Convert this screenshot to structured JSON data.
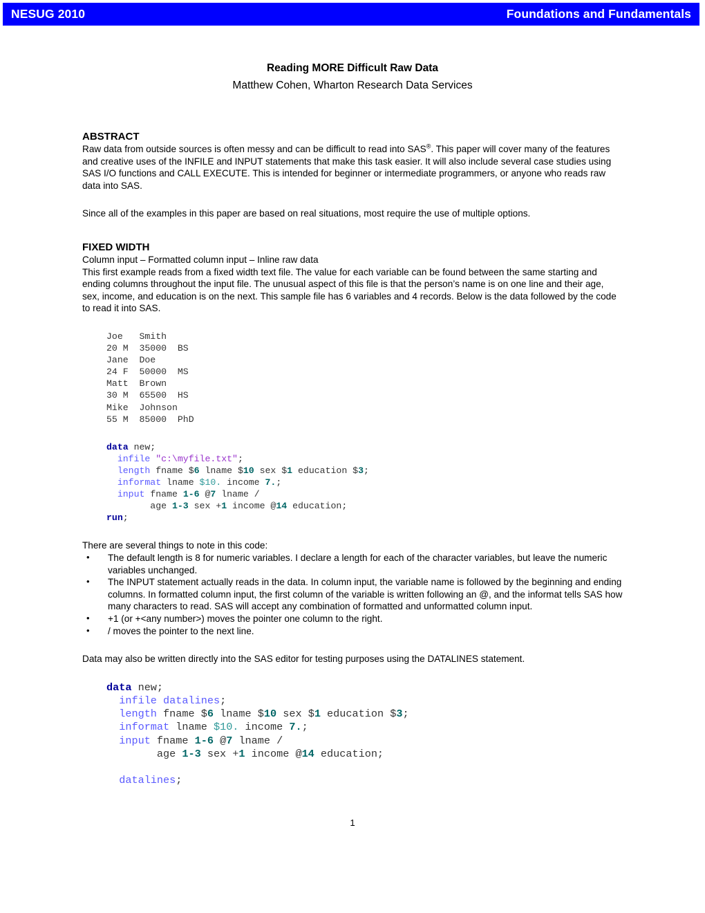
{
  "header": {
    "left": "NESUG 2010",
    "right": "Foundations and Fundamentals",
    "banner_color": "#0000FF",
    "text_color": "#FFFFFF"
  },
  "title": {
    "heading": "Reading MORE Difficult Raw Data",
    "authors": "Matthew Cohen,  Wharton Research Data Services"
  },
  "abstract": {
    "heading": "ABSTRACT",
    "paragraph_1_part_1": "Raw data from outside sources is often messy and can be difficult to read into SAS",
    "paragraph_1_superscript": "®",
    "paragraph_1_part_2": ". This paper will cover many of the features and creative uses of the INFILE and INPUT statements that make this task easier. It will also include several case studies using SAS I/O functions and CALL EXECUTE. This is intended for beginner or intermediate programmers, or anyone who reads raw data into SAS.",
    "paragraph_2": "Since all of the examples in this paper are based on real situations, most require the use of multiple options."
  },
  "fixed_width": {
    "heading": "FIXED WIDTH",
    "subtitle": "Column input – Formatted column input – Inline raw data",
    "paragraph": "This first example reads from a fixed width text file.  The value for each variable can be found between the same starting and ending columns throughout the input file.  The unusual aspect of this file is that the person’s name is on one line and their age, sex, income, and education is on the next.  This sample file has 6 variables and 4 records.  Below is the data followed by the code to read it into SAS."
  },
  "raw_data_block": "Joe   Smith\n20 M  35000  BS\nJane  Doe\n24 F  50000  MS\nMatt  Brown\n30 M  65500  HS\nMike  Johnson\n55 M  85000  PhD",
  "code_block_1": {
    "lines": [
      [
        {
          "t": "data",
          "c": "k-step"
        },
        {
          "t": " new;",
          "c": "k-plain"
        }
      ],
      [
        {
          "t": "  ",
          "c": "k-plain"
        },
        {
          "t": "infile",
          "c": "k-stmt"
        },
        {
          "t": " ",
          "c": "k-plain"
        },
        {
          "t": "\"c:\\myfile.txt\"",
          "c": "k-str"
        },
        {
          "t": ";",
          "c": "k-plain"
        }
      ],
      [
        {
          "t": "  ",
          "c": "k-plain"
        },
        {
          "t": "length",
          "c": "k-stmt"
        },
        {
          "t": " fname $",
          "c": "k-plain"
        },
        {
          "t": "6",
          "c": "k-num"
        },
        {
          "t": " lname $",
          "c": "k-plain"
        },
        {
          "t": "10",
          "c": "k-num"
        },
        {
          "t": " sex $",
          "c": "k-plain"
        },
        {
          "t": "1",
          "c": "k-num"
        },
        {
          "t": " education $",
          "c": "k-plain"
        },
        {
          "t": "3",
          "c": "k-num"
        },
        {
          "t": ";",
          "c": "k-plain"
        }
      ],
      [
        {
          "t": "  ",
          "c": "k-plain"
        },
        {
          "t": "informat",
          "c": "k-stmt"
        },
        {
          "t": " lname ",
          "c": "k-plain"
        },
        {
          "t": "$10.",
          "c": "k-fmt"
        },
        {
          "t": " income ",
          "c": "k-plain"
        },
        {
          "t": "7.",
          "c": "k-num"
        },
        {
          "t": ";",
          "c": "k-plain"
        }
      ],
      [
        {
          "t": "  ",
          "c": "k-plain"
        },
        {
          "t": "input",
          "c": "k-stmt"
        },
        {
          "t": " fname ",
          "c": "k-plain"
        },
        {
          "t": "1-6",
          "c": "k-num"
        },
        {
          "t": " @",
          "c": "k-plain"
        },
        {
          "t": "7",
          "c": "k-num"
        },
        {
          "t": " lname /",
          "c": "k-plain"
        }
      ],
      [
        {
          "t": "        age ",
          "c": "k-plain"
        },
        {
          "t": "1-3",
          "c": "k-num"
        },
        {
          "t": " sex +",
          "c": "k-plain"
        },
        {
          "t": "1",
          "c": "k-num"
        },
        {
          "t": " income @",
          "c": "k-plain"
        },
        {
          "t": "14",
          "c": "k-num"
        },
        {
          "t": " education;",
          "c": "k-plain"
        }
      ],
      [
        {
          "t": "run",
          "c": "k-step"
        },
        {
          "t": ";",
          "c": "k-plain"
        }
      ]
    ]
  },
  "notes": {
    "intro": "There are several things to note in this code:",
    "items": [
      "The default length is 8 for numeric variables.  I declare a length for each of the character variables, but leave the numeric variables unchanged.",
      "The INPUT statement actually reads in the data.  In column input, the variable name is followed by the beginning and ending columns.  In formatted column input, the first column of the variable is written following an @, and the informat tells SAS how many characters to read.  SAS will accept any combination of formatted and unformatted column input.",
      "+1 (or +<any number>) moves the pointer one column to the right.",
      "/ moves the pointer to the next line."
    ]
  },
  "datalines_paragraph": "Data may also be written directly into the SAS editor for testing purposes using the DATALINES statement.",
  "code_block_2": {
    "lines": [
      [
        {
          "t": "data",
          "c": "k-step"
        },
        {
          "t": " new;",
          "c": "k-plain"
        }
      ],
      [
        {
          "t": "  ",
          "c": "k-plain"
        },
        {
          "t": "infile",
          "c": "k-stmt"
        },
        {
          "t": " ",
          "c": "k-plain"
        },
        {
          "t": "datalines",
          "c": "k-stmt"
        },
        {
          "t": ";",
          "c": "k-plain"
        }
      ],
      [
        {
          "t": "  ",
          "c": "k-plain"
        },
        {
          "t": "length",
          "c": "k-stmt"
        },
        {
          "t": " fname $",
          "c": "k-plain"
        },
        {
          "t": "6",
          "c": "k-num"
        },
        {
          "t": " lname $",
          "c": "k-plain"
        },
        {
          "t": "10",
          "c": "k-num"
        },
        {
          "t": " sex $",
          "c": "k-plain"
        },
        {
          "t": "1",
          "c": "k-num"
        },
        {
          "t": " education $",
          "c": "k-plain"
        },
        {
          "t": "3",
          "c": "k-num"
        },
        {
          "t": ";",
          "c": "k-plain"
        }
      ],
      [
        {
          "t": "  ",
          "c": "k-plain"
        },
        {
          "t": "informat",
          "c": "k-stmt"
        },
        {
          "t": " lname ",
          "c": "k-plain"
        },
        {
          "t": "$10.",
          "c": "k-fmt"
        },
        {
          "t": " income ",
          "c": "k-plain"
        },
        {
          "t": "7.",
          "c": "k-num"
        },
        {
          "t": ";",
          "c": "k-plain"
        }
      ],
      [
        {
          "t": "  ",
          "c": "k-plain"
        },
        {
          "t": "input",
          "c": "k-stmt"
        },
        {
          "t": " fname ",
          "c": "k-plain"
        },
        {
          "t": "1-6",
          "c": "k-num"
        },
        {
          "t": " @",
          "c": "k-plain"
        },
        {
          "t": "7",
          "c": "k-num"
        },
        {
          "t": " lname /",
          "c": "k-plain"
        }
      ],
      [
        {
          "t": "        age ",
          "c": "k-plain"
        },
        {
          "t": "1-3",
          "c": "k-num"
        },
        {
          "t": " sex +",
          "c": "k-plain"
        },
        {
          "t": "1",
          "c": "k-num"
        },
        {
          "t": " income @",
          "c": "k-plain"
        },
        {
          "t": "14",
          "c": "k-num"
        },
        {
          "t": " education;",
          "c": "k-plain"
        }
      ],
      [
        {
          "t": "",
          "c": "k-plain"
        }
      ],
      [
        {
          "t": "  ",
          "c": "k-plain"
        },
        {
          "t": "datalines",
          "c": "k-stmt"
        },
        {
          "t": ";",
          "c": "k-plain"
        }
      ]
    ]
  },
  "footer": {
    "page_number": "1"
  }
}
